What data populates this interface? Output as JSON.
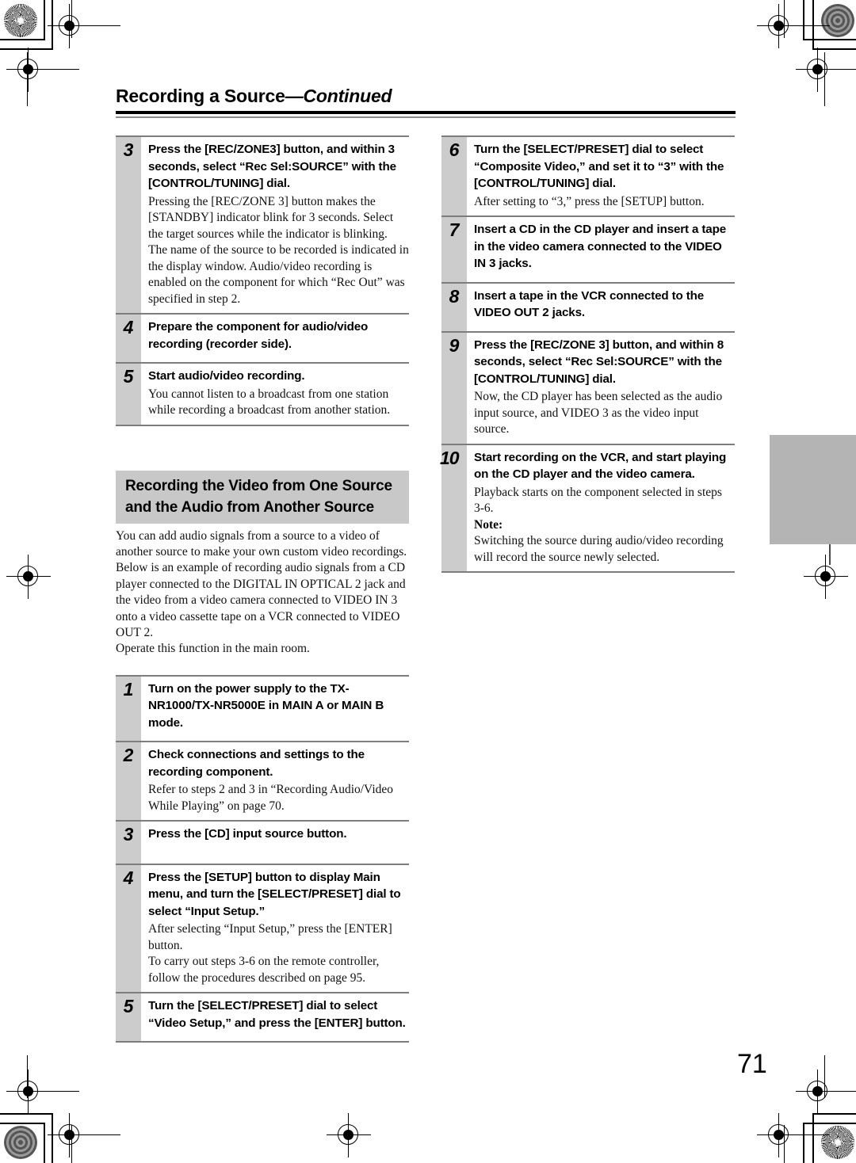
{
  "page": {
    "header_title_main": "Recording a Source",
    "header_title_cont": "—Continued",
    "page_number": "71"
  },
  "left_column": {
    "steps_group_a": [
      {
        "num": "3",
        "title": "Press the [REC/ZONE3] button, and within 3 seconds, select “Rec Sel:SOURCE” with the [CONTROL/TUNING] dial.",
        "body": "Pressing the [REC/ZONE 3] button makes the [STANDBY] indicator blink for 3 seconds. Select the target sources while the indicator is blinking. The name of the source to be recorded is indicated in the display window. Audio/video recording is enabled on the component for which “Rec Out” was specified in step 2."
      },
      {
        "num": "4",
        "title": "Prepare the component for audio/video recording (recorder side).",
        "body": ""
      },
      {
        "num": "5",
        "title": "Start audio/video recording.",
        "body": "You cannot listen to a broadcast from one station while recording a broadcast from another station."
      }
    ],
    "section": {
      "heading": "Recording the Video from One Source and the Audio from Another Source",
      "paragraph_1": "You can add audio signals from a source to a video of another source to make your own custom video recordings. Below is an example of recording audio signals from a CD player connected to the DIGITAL IN OPTICAL 2 jack and the video from a video camera connected to VIDEO IN 3 onto a video cassette tape on a VCR connected to VIDEO OUT 2.",
      "paragraph_2": "Operate this function in the main room."
    },
    "steps_group_b": [
      {
        "num": "1",
        "title": "Turn on the power supply to the TX-NR1000/TX-NR5000E in MAIN A or MAIN B mode.",
        "body": ""
      },
      {
        "num": "2",
        "title": "Check connections and settings to the recording component.",
        "body": "Refer to steps 2 and 3 in “Recording Audio/Video While Playing” on page 70."
      },
      {
        "num": "3",
        "title": "Press the [CD] input source button.",
        "body": ""
      },
      {
        "num": "4",
        "title": "Press the [SETUP] button to display Main menu, and turn the [SELECT/PRESET] dial to select “Input Setup.”",
        "body_1": "After selecting “Input Setup,” press the [ENTER] button.",
        "body_2": "To carry out steps 3-6 on the remote controller, follow the procedures described on page 95."
      },
      {
        "num": "5",
        "title": "Turn the [SELECT/PRESET] dial to select “Video Setup,” and press the [ENTER] button.",
        "body": ""
      }
    ]
  },
  "right_column": {
    "steps": [
      {
        "num": "6",
        "title": "Turn the [SELECT/PRESET] dial to select “Composite Video,” and set it to “3” with the [CONTROL/TUNING] dial.",
        "body": "After setting to “3,” press the [SETUP] button."
      },
      {
        "num": "7",
        "title": "Insert a CD in the CD player and insert a tape in the video camera connected to the VIDEO IN 3 jacks.",
        "body": ""
      },
      {
        "num": "8",
        "title": "Insert a tape in the VCR connected to the VIDEO OUT 2 jacks.",
        "body": ""
      },
      {
        "num": "9",
        "title": "Press the [REC/ZONE 3] button, and within 8 seconds, select “Rec Sel:SOURCE” with the [CONTROL/TUNING] dial.",
        "body": "Now, the CD player has been selected as the audio input source, and VIDEO 3 as the video input source."
      },
      {
        "num": "10",
        "title": "Start recording on the VCR, and start playing on the CD player and the video camera.",
        "body": "Playback starts on the component selected in steps 3-6.",
        "note_label": "Note:",
        "note_body": "Switching the source during audio/video recording will record the source newly selected."
      }
    ]
  },
  "print_marks": {
    "registration_mark": "registration-target",
    "star_patch": "star-target-patch",
    "ring_patch": "concentric-ring-patch",
    "thumb_tab": "chapter-thumb-tab"
  }
}
